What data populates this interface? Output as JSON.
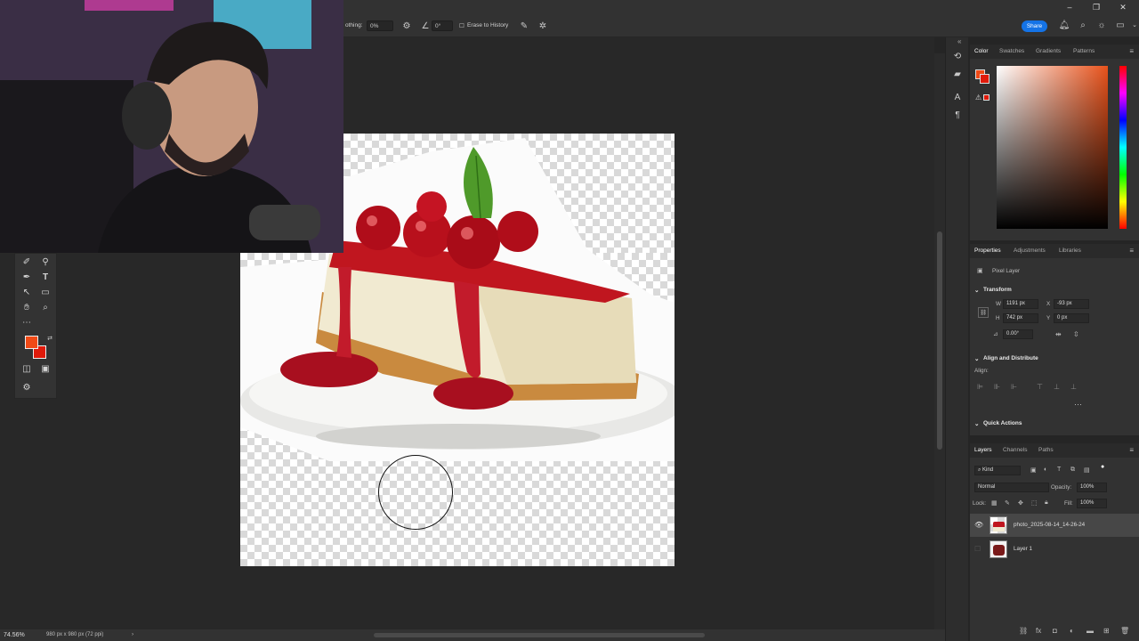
{
  "options_bar": {
    "smoothing_label": "othing:",
    "smoothing_value": "0%",
    "angle_value": "0°",
    "erase_to_history_label": "Erase to History",
    "share_label": "Share"
  },
  "status_bar": {
    "zoom": "74.56%",
    "doc_info": "980 px x 980 px (72 ppi)"
  },
  "color_panel": {
    "tabs": [
      "Color",
      "Swatches",
      "Gradients",
      "Patterns"
    ],
    "foreground_color": "#f14a16",
    "background_color": "#e01a0a"
  },
  "properties_panel": {
    "tabs": [
      "Properties",
      "Adjustments",
      "Libraries"
    ],
    "layer_type": "Pixel Layer",
    "transform_title": "Transform",
    "w_label": "W",
    "w_value": "1191 px",
    "h_label": "H",
    "h_value": "742 px",
    "x_label": "X",
    "x_value": "-93 px",
    "y_label": "Y",
    "y_value": "0 px",
    "angle_value": "0.00°",
    "align_title": "Align and Distribute",
    "align_label": "Align:",
    "quick_actions_title": "Quick Actions"
  },
  "layers_panel": {
    "tabs": [
      "Layers",
      "Channels",
      "Paths"
    ],
    "kind_label": "Kind",
    "blend_mode": "Normal",
    "opacity_label": "Opacity:",
    "opacity_value": "100%",
    "lock_label": "Lock:",
    "fill_label": "Fill:",
    "fill_value": "100%",
    "layers": [
      {
        "name": "photo_2025-08-14_14-26-24",
        "visible": true,
        "selected": true
      },
      {
        "name": "Layer 1",
        "visible": false,
        "selected": false
      }
    ]
  },
  "icons": {
    "tools": [
      "spot-healing-icon",
      "zoom-magnifier-icon",
      "pen-icon",
      "type-icon",
      "path-selection-icon",
      "rectangle-icon",
      "hand-icon",
      "zoom-icon",
      "more-tools-icon",
      "quick-mask-icon",
      "screen-mode-icon",
      "edit-toolbar-icon"
    ],
    "strip": [
      "history-icon",
      "comment-icon",
      "character-icon",
      "paragraph-icon"
    ]
  }
}
